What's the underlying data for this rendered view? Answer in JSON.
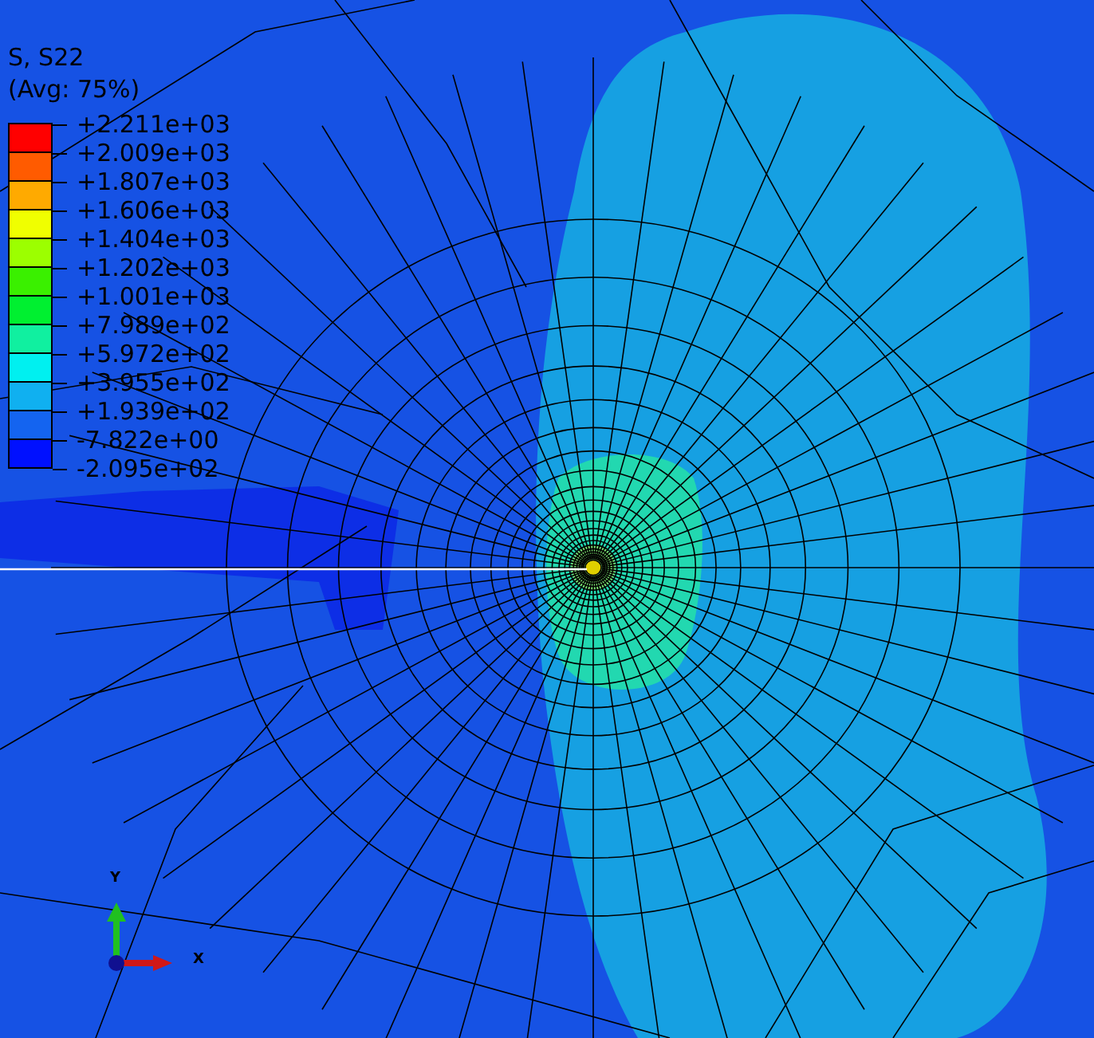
{
  "legend": {
    "title": "S, S22",
    "subtitle": "(Avg: 75%)",
    "bands": [
      {
        "color": "#ff0000"
      },
      {
        "color": "#ff5b00"
      },
      {
        "color": "#ffaa00"
      },
      {
        "color": "#f0ff00"
      },
      {
        "color": "#9cff00"
      },
      {
        "color": "#3af000"
      },
      {
        "color": "#00f030"
      },
      {
        "color": "#10f0a0"
      },
      {
        "color": "#00f0f0"
      },
      {
        "color": "#10b0f0"
      },
      {
        "color": "#1464f0"
      },
      {
        "color": "#0010ff"
      }
    ],
    "tick_labels": [
      "+2.211e+03",
      "+2.009e+03",
      "+1.807e+03",
      "+1.606e+03",
      "+1.404e+03",
      "+1.202e+03",
      "+1.001e+03",
      "+7.989e+02",
      "+5.972e+02",
      "+3.955e+02",
      "+1.939e+02",
      "-7.822e+00",
      "-2.095e+02"
    ]
  },
  "triad": {
    "y_label": "Y",
    "x_label": "X"
  }
}
